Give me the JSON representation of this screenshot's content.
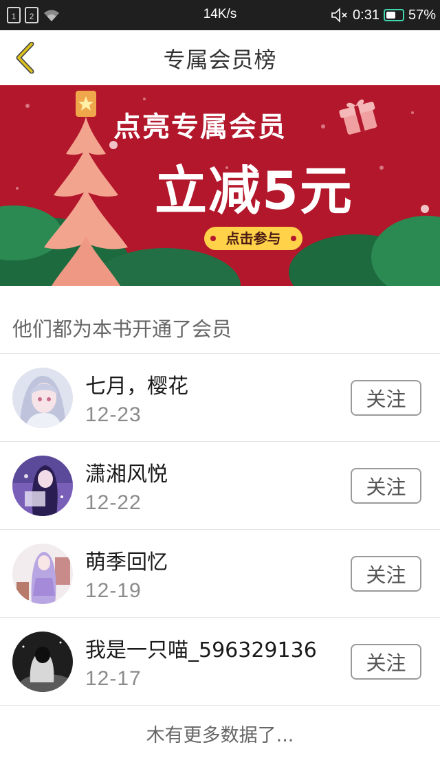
{
  "status_bar": {
    "sim1": "1",
    "sim2": "2",
    "speed": "14K/s",
    "time": "0:31",
    "battery": "57%",
    "battery_level": 0.57,
    "wifi_icon": "wifi-icon",
    "mute_icon": "mute-icon"
  },
  "header": {
    "title": "专属会员榜",
    "back_icon": "chevron-left-icon",
    "accent": "#ddc31b"
  },
  "banner": {
    "headline": "点亮专属会员",
    "offer": "立减5元",
    "cta": "点击参与",
    "background": "#b3172b"
  },
  "section": {
    "title": "他们都为本书开通了会员"
  },
  "members": [
    {
      "name": "七月，樱花",
      "date": "12-23",
      "follow_label": "关注"
    },
    {
      "name": "潇湘风悦",
      "date": "12-22",
      "follow_label": "关注"
    },
    {
      "name": "萌季回忆",
      "date": "12-19",
      "follow_label": "关注"
    },
    {
      "name": "我是一只喵_596329136",
      "date": "12-17",
      "follow_label": "关注"
    }
  ],
  "footer": {
    "text": "木有更多数据了..."
  }
}
